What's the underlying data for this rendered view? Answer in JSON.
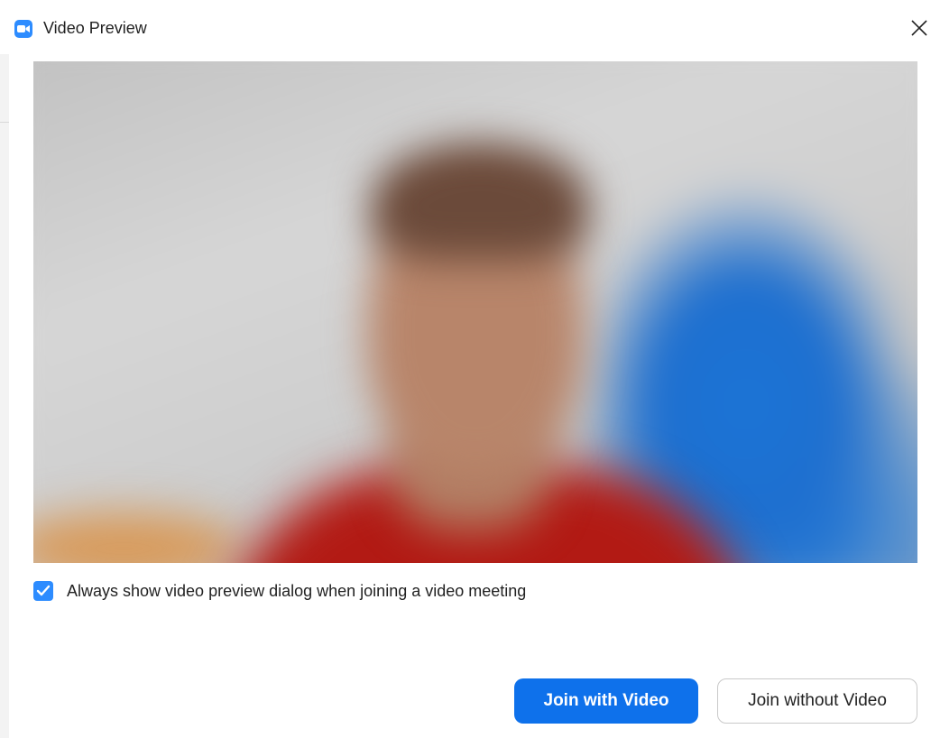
{
  "window": {
    "title": "Video Preview",
    "app_icon": "zoom-camera-icon",
    "close_icon": "close-icon"
  },
  "preview": {
    "checkbox_checked": true,
    "checkbox_label": "Always show video preview dialog when joining a video meeting"
  },
  "buttons": {
    "join_with_video": "Join with Video",
    "join_without_video": "Join without Video"
  },
  "colors": {
    "accent": "#0e71eb",
    "checkbox": "#2d8cff"
  }
}
